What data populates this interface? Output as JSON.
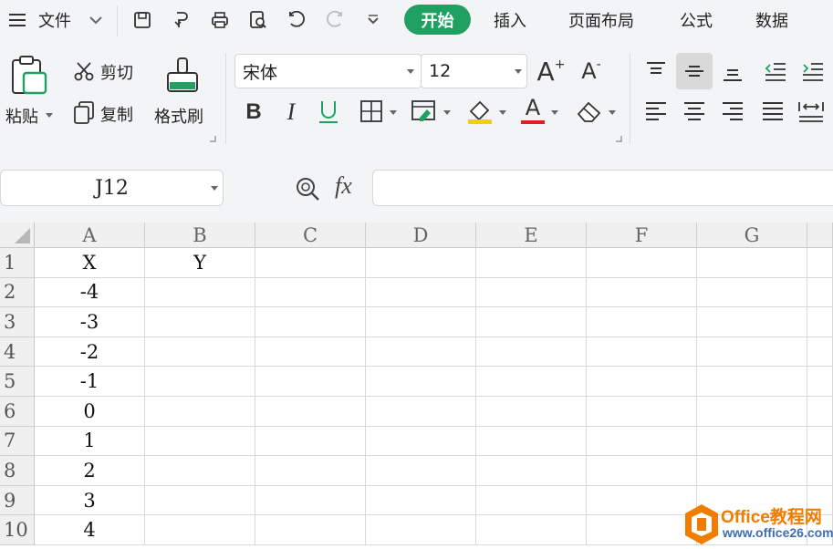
{
  "menu": {
    "file_label": "文件",
    "tabs": [
      {
        "label": "开始",
        "active": true
      },
      {
        "label": "插入"
      },
      {
        "label": "页面布局"
      },
      {
        "label": "公式"
      },
      {
        "label": "数据"
      }
    ]
  },
  "ribbon": {
    "paste_label": "粘贴",
    "cut_label": "剪切",
    "copy_label": "复制",
    "format_painter_label": "格式刷",
    "font_name": "宋体",
    "font_size": "12",
    "bold_glyph": "B",
    "italic_glyph": "I",
    "underline_glyph": "U",
    "font_color_glyph": "A",
    "grow_font_glyph": "A",
    "shrink_font_glyph": "A"
  },
  "formula_bar": {
    "name_box": "J12",
    "fx_label": "fx",
    "formula": ""
  },
  "sheet": {
    "columns": [
      "A",
      "B",
      "C",
      "D",
      "E",
      "F",
      "G"
    ],
    "rows": [
      "1",
      "2",
      "3",
      "4",
      "5",
      "6",
      "7",
      "8",
      "9",
      "10"
    ],
    "cells": [
      [
        "X",
        "Y"
      ],
      [
        "-4",
        ""
      ],
      [
        "-3",
        ""
      ],
      [
        "-2",
        ""
      ],
      [
        "-1",
        ""
      ],
      [
        "0",
        ""
      ],
      [
        "1",
        ""
      ],
      [
        "2",
        ""
      ],
      [
        "3",
        ""
      ],
      [
        "4",
        ""
      ]
    ]
  },
  "watermark": {
    "title": "Office教程网",
    "url": "www.office26.com"
  },
  "colors": {
    "accent": "#20a162",
    "font_color_bar": "#e02020",
    "highlight_bar": "#f5d000"
  }
}
